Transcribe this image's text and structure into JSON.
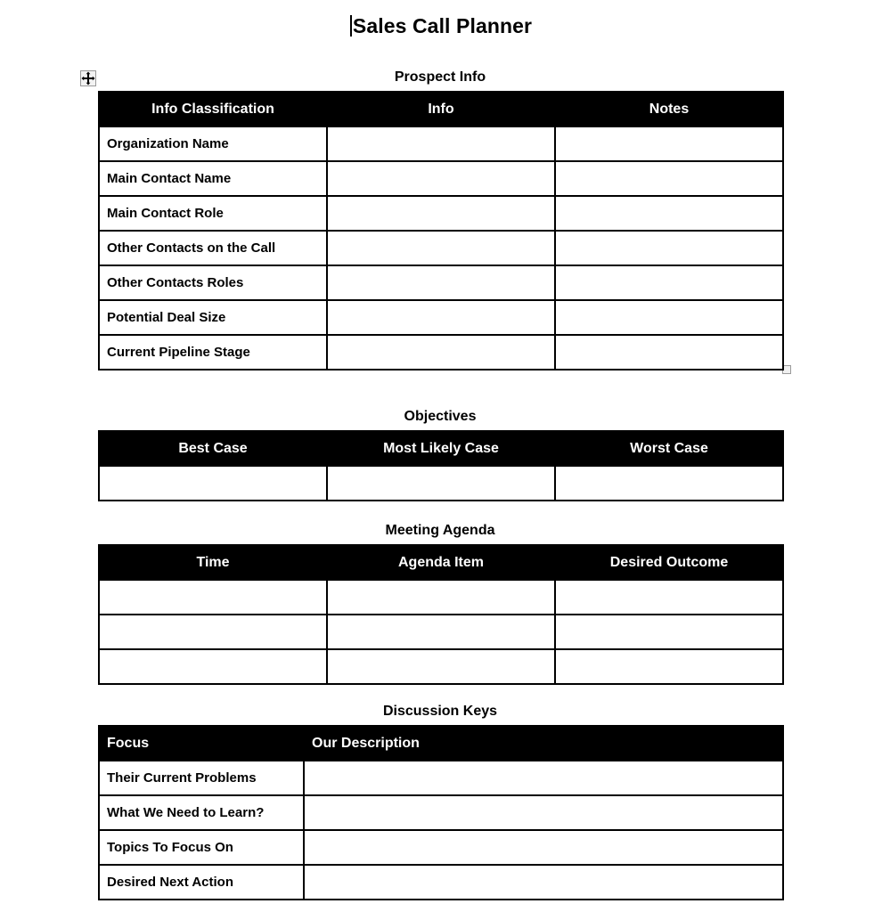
{
  "document": {
    "title": "Sales Call Planner",
    "caret_visible": true
  },
  "handles": {
    "move_handle_icon": "move-cross-icon",
    "resize_handle_icon": "resize-square-icon"
  },
  "sections": [
    {
      "id": "prospect",
      "title": "Prospect Info",
      "header_align": "center",
      "columns": [
        "Info Classification",
        "Info",
        "Notes"
      ],
      "rows": [
        [
          "Organization Name",
          "",
          ""
        ],
        [
          "Main Contact Name",
          "",
          ""
        ],
        [
          "Main Contact Role",
          "",
          ""
        ],
        [
          "Other Contacts on the Call",
          "",
          ""
        ],
        [
          "Other Contacts Roles",
          "",
          ""
        ],
        [
          "Potential Deal Size",
          "",
          ""
        ],
        [
          "Current Pipeline Stage",
          "",
          ""
        ]
      ]
    },
    {
      "id": "objectives",
      "title": "Objectives",
      "header_align": "center",
      "columns": [
        "Best Case",
        "Most Likely Case",
        "Worst Case"
      ],
      "rows": [
        [
          "",
          "",
          ""
        ]
      ]
    },
    {
      "id": "agenda",
      "title": "Meeting Agenda",
      "header_align": "center",
      "columns": [
        "Time",
        "Agenda Item",
        "Desired Outcome"
      ],
      "rows": [
        [
          "",
          "",
          ""
        ],
        [
          "",
          "",
          ""
        ],
        [
          "",
          "",
          ""
        ]
      ]
    },
    {
      "id": "discussion",
      "title": "Discussion Keys",
      "header_align": "left",
      "columns": [
        "Focus",
        "Our Description"
      ],
      "rows": [
        [
          "Their Current Problems",
          ""
        ],
        [
          "What We Need to Learn?",
          ""
        ],
        [
          "Topics To Focus On",
          ""
        ],
        [
          "Desired Next Action",
          ""
        ]
      ]
    }
  ],
  "colors": {
    "header_background": "#000000",
    "header_text": "#ffffff",
    "body_background": "#ffffff",
    "border": "#000000",
    "page_background": "#ffffff"
  }
}
